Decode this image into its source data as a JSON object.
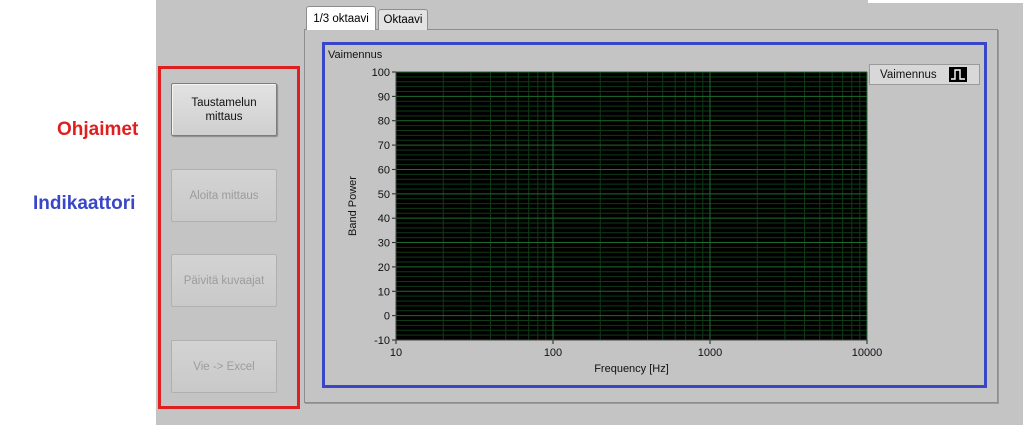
{
  "side_labels": {
    "controls": "Ohjaimet",
    "indicator": "Indikaattori"
  },
  "buttons": [
    {
      "label": "Taustamelun mittaus",
      "enabled": true
    },
    {
      "label": "Aloita mittaus",
      "enabled": false
    },
    {
      "label": "Päivitä kuvaajat",
      "enabled": false
    },
    {
      "label": "Vie -> Excel",
      "enabled": false
    }
  ],
  "tabs": [
    {
      "label": "1/3 oktaavi",
      "selected": true
    },
    {
      "label": "Oktaavi",
      "selected": false
    }
  ],
  "colors": {
    "controls_outline": "#e02020",
    "indicator_outline": "#3a46c8",
    "plot_background": "#000000",
    "grid_major": "#1f6b2a",
    "grid_minor": "#0f3a16"
  },
  "legend": {
    "label": "Vaimennus",
    "icon": "step-plot-icon"
  },
  "chart_data": {
    "type": "line",
    "title": "Vaimennus",
    "xlabel": "Frequency [Hz]",
    "ylabel": "Band Power",
    "x_scale": "log",
    "xlim": [
      10,
      10000
    ],
    "ylim": [
      -10,
      100
    ],
    "x_ticks": [
      "10",
      "100",
      "1000",
      "10000"
    ],
    "y_ticks": [
      "100",
      "90",
      "80",
      "70",
      "60",
      "50",
      "40",
      "30",
      "20",
      "10",
      "0",
      "-10"
    ],
    "grid": true,
    "legend_position": "top-right",
    "series": []
  }
}
